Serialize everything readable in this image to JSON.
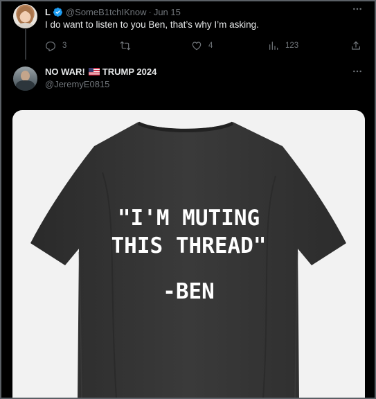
{
  "reply_tweet": {
    "display_name": "L",
    "handle": "@SomeB1tchIKnow",
    "separator": "·",
    "date": "Jun 15",
    "text": "I do want to listen to you Ben, that’s why I’m asking.",
    "more_icon": "more-horizontal-icon",
    "stats": {
      "replies": "3",
      "retweets": "",
      "likes": "4",
      "views": "123"
    }
  },
  "main_tweet": {
    "display_name_left": "NO WAR!",
    "flag_icon": "us-flag-icon",
    "display_name_right": "TRUMP 2024",
    "handle": "@JeremyE0815",
    "more_icon": "more-horizontal-icon",
    "media": {
      "description_icon": "black-tshirt-image",
      "print_lines": [
        "\"I'M MUTING",
        "THIS THREAD\"",
        "-BEN"
      ]
    }
  },
  "colors": {
    "background": "#000000",
    "text": "#e7e9ea",
    "muted": "#71767b",
    "verified": "#1d9bf0",
    "shirt": "#333333",
    "media_background": "#f2f2f2"
  }
}
